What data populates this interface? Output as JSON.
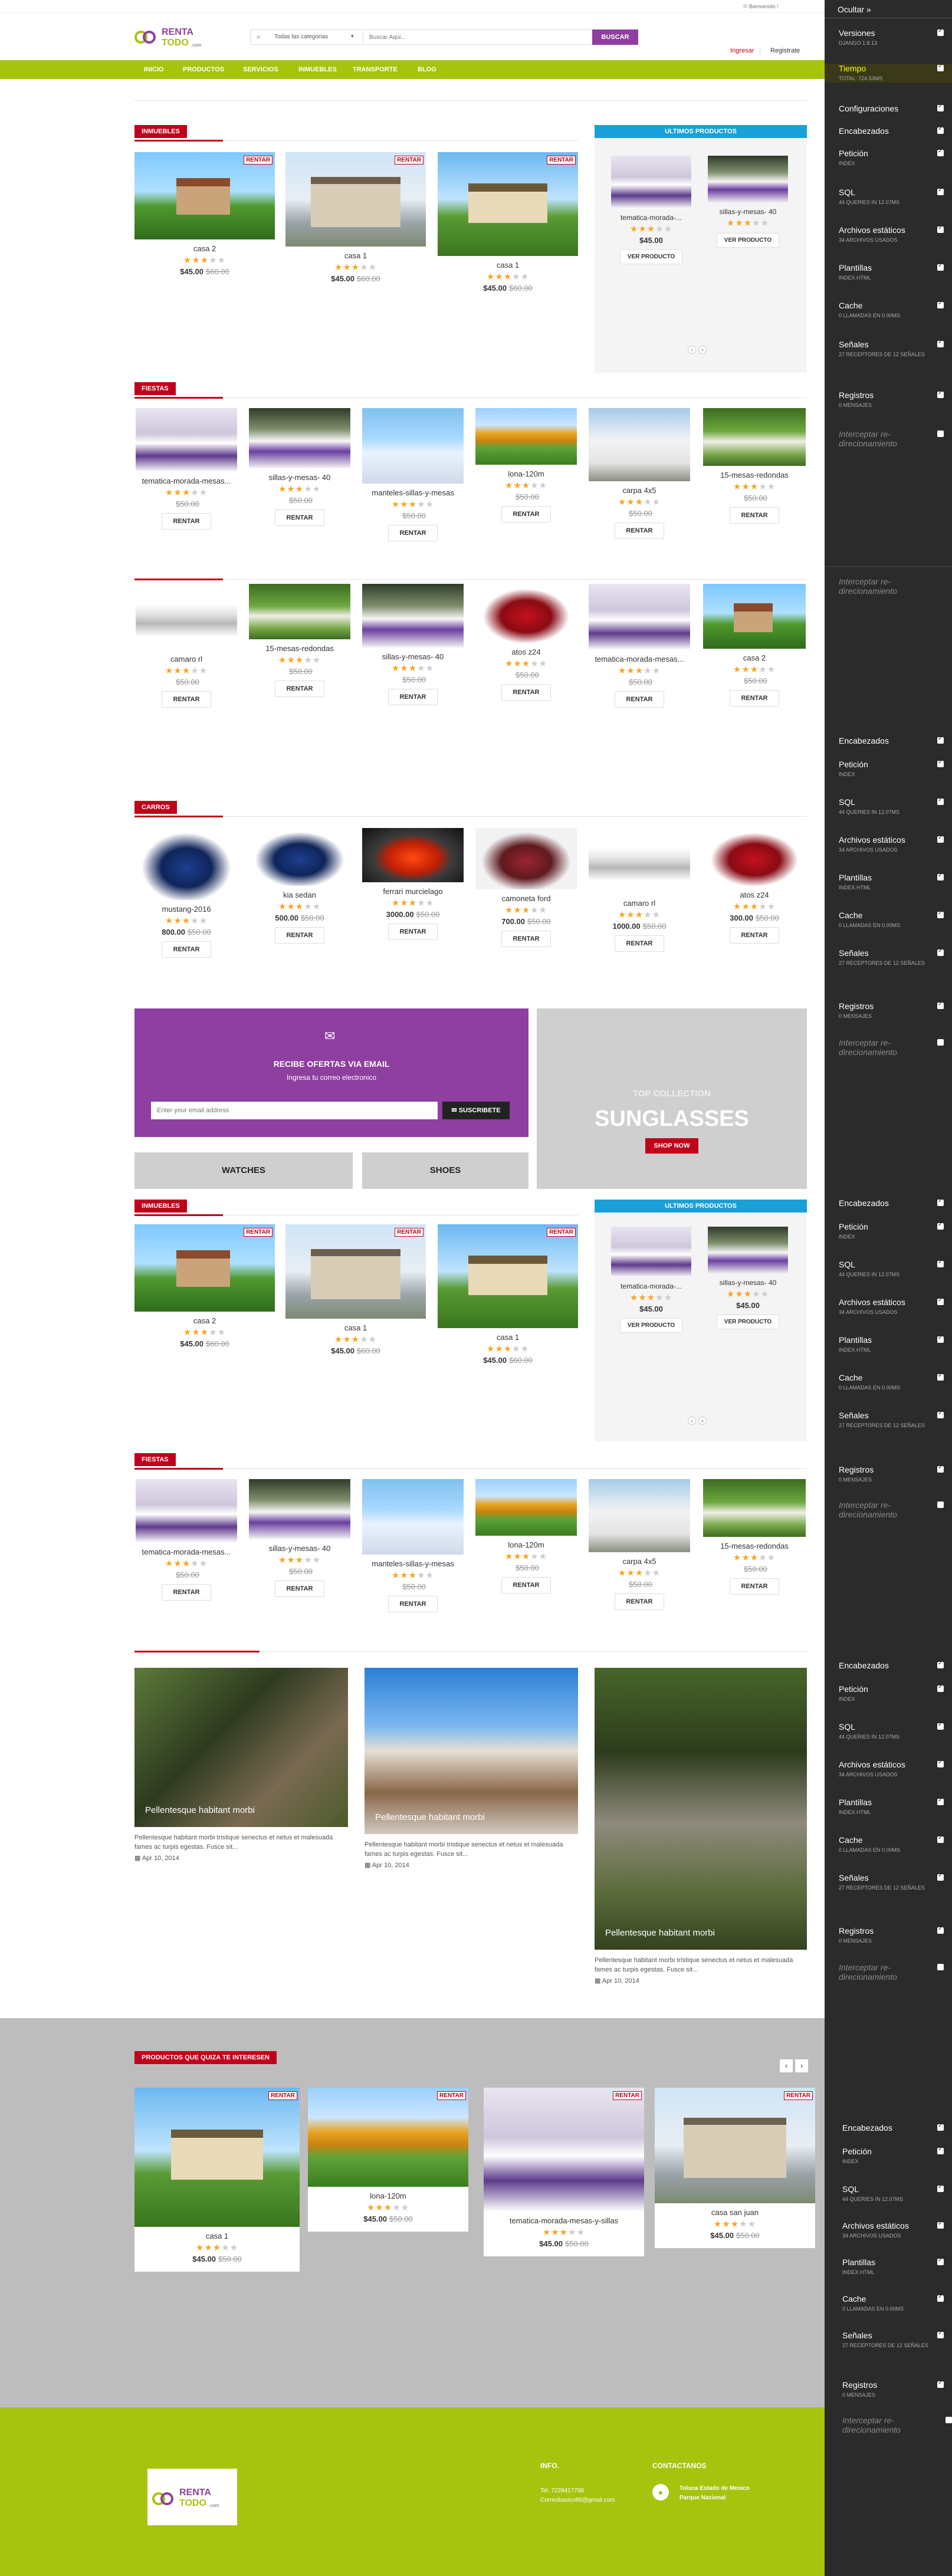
{
  "topbar": {
    "phone_icon": "phone-icon",
    "welcome": "Bienvenido !"
  },
  "logo": {
    "line1": "RENTA",
    "line2": "TODO",
    "suffix": ".com"
  },
  "search": {
    "category": "Todas las categorias",
    "placeholder": "Buscar Aqui...",
    "button": "BUSCAR"
  },
  "account": {
    "login": "Ingresar",
    "register": "Registrate"
  },
  "nav": [
    "INICIO",
    "PRODUCTOS",
    "SERVICIOS",
    "INMUEBLES",
    "TRANSPORTE",
    "BLOG"
  ],
  "colors": {
    "lime": "#a6c40e",
    "purple": "#8e3fa0",
    "red": "#c0001a",
    "cyan": "#1aa0d8"
  },
  "rent_tag": "RENTAR",
  "inmuebles": {
    "title": "INMUEBLES",
    "items": [
      {
        "name": "casa 2",
        "rating": 3,
        "price": "$45.00",
        "old": "$60.00"
      },
      {
        "name": "casa 1",
        "rating": 3,
        "price": "$45.00",
        "old": "$60.00"
      },
      {
        "name": "casa 1",
        "rating": 3,
        "price": "$45.00",
        "old": "$60.00"
      }
    ]
  },
  "ultimos": {
    "title": "ULTIMOS PRODUCTOS",
    "items": [
      {
        "name": "tematica-morada-...",
        "rating": 3,
        "price": "$45.00",
        "btn": "VER PRODUCTO"
      },
      {
        "name": "sillas-y-mesas- 40",
        "rating": 3,
        "price": "$45.00",
        "btn": "VER PRODUCTO"
      }
    ]
  },
  "fiestas": {
    "title": "FIESTAS",
    "row1": [
      {
        "name": "tematica-morada-mesas...",
        "rating": 3,
        "old": "$50.00"
      },
      {
        "name": "sillas-y-mesas- 40",
        "rating": 3,
        "old": "$50.00"
      },
      {
        "name": "manteles-sillas-y-mesas",
        "rating": 3,
        "old": "$50.00"
      },
      {
        "name": "lona-120m",
        "rating": 3,
        "old": "$50.00"
      },
      {
        "name": "carpa 4x5",
        "rating": 3,
        "old": "$50.00"
      },
      {
        "name": "15-mesas-redondas",
        "rating": 3,
        "old": "$50.00"
      }
    ],
    "row2": [
      {
        "name": "camaro rl",
        "rating": 3,
        "old": "$50.00"
      },
      {
        "name": "15-mesas-redondas",
        "rating": 3,
        "old": "$50.00"
      },
      {
        "name": "sillas-y-mesas- 40",
        "rating": 3,
        "old": "$50.00"
      },
      {
        "name": "atos z24",
        "rating": 3,
        "old": "$50.00"
      },
      {
        "name": "tematica-morada-mesas...",
        "rating": 3,
        "old": "$50.00"
      },
      {
        "name": "casa 2",
        "rating": 3,
        "old": "$50.00"
      }
    ],
    "btn": "RENTAR"
  },
  "carros": {
    "title": "CARROS",
    "items": [
      {
        "name": "mustang-2016",
        "rating": 3,
        "price": "800.00",
        "old": "$50.00"
      },
      {
        "name": "kia sedan",
        "rating": 3,
        "price": "500.00",
        "old": "$50.00"
      },
      {
        "name": "ferrari murcielago",
        "rating": 3,
        "price": "3000.00",
        "old": "$50.00"
      },
      {
        "name": "camoneta ford",
        "rating": 3,
        "price": "700.00",
        "old": "$50.00"
      },
      {
        "name": "camaro rl",
        "rating": 3,
        "price": "1000.00",
        "old": "$50.00"
      },
      {
        "name": "atos z24",
        "rating": 3,
        "price": "300.00",
        "old": "$50.00"
      }
    ]
  },
  "newsletter": {
    "title": "RECIBE OFERTAS VIA EMAIL",
    "subtitle": "Ingresa tu correo electronico",
    "placeholder": "Enter your email address",
    "button": "SUSCRIBETE"
  },
  "promo": {
    "kicker": "TOP COLLECTION",
    "title": "SUNGLASSES",
    "button": "SHOP NOW"
  },
  "watches": "WATCHES",
  "shoes": "SHOES",
  "blog": {
    "items": [
      {
        "title": "Pellentesque habitant morbi",
        "text": "Pellentesque habitant morbi tristique senectus et netus et malesuada fames ac turpis egestas. Fusce sit...",
        "date": "Apr 10, 2014"
      },
      {
        "title": "Pellentesque habitant morbi",
        "text": "Pellentesque habitant morbi tristique senectus et netus et malesuada fames ac turpis egestas. Fusce sit...",
        "date": "Apr 10, 2014"
      },
      {
        "title": "Pellentesque habitant morbi",
        "text": "Pellentesque habitant morbi tristique senectus et netus et malesuada fames ac turpis egestas. Fusce sit...",
        "date": "Apr 10, 2014"
      }
    ]
  },
  "interest": {
    "title": "PRODUCTOS QUE QUIZA TE INTERESEN",
    "items": [
      {
        "name": "casa 1",
        "rating": 3,
        "price": "$45.00",
        "old": "$50.00"
      },
      {
        "name": "lona-120m",
        "rating": 3,
        "price": "$45.00",
        "old": "$50.00"
      },
      {
        "name": "tematica-morada-mesas-y-sillas",
        "rating": 3,
        "price": "$45.00",
        "old": "$50.00"
      },
      {
        "name": "casa san juan",
        "rating": 3,
        "price": "$45.00",
        "old": "$50.00"
      }
    ]
  },
  "footer": {
    "info_title": "INFO.",
    "phone": "Tel. 7228417788",
    "email": "Correobasico88@gmail.com",
    "contact_title": "CONTACTANOS",
    "address1": "Toluca Estado de Mexico",
    "address2": "Parque Nacional"
  },
  "debug": {
    "hide": "Ocultar »",
    "versions": "Versiones",
    "versions_sub": "DJANGO 1.8.13",
    "time": "Tiempo",
    "time_sub": "TOTAL: 724.53ms",
    "config": "Configuraciones",
    "headers": "Encabezados",
    "request": "Petición",
    "request_sub": "INDEX",
    "sql": "SQL",
    "sql_sub": "44 QUERIES IN 12.07ms",
    "static": "Archivos estáticos",
    "static_sub": "34 ARCHIVOS USADOS",
    "templates": "Plantillas",
    "templates_sub": "INDEX.HTML",
    "cache": "Cache",
    "cache_sub": "0 LLAMADAS EN 0.00ms",
    "signals": "Señales",
    "signals_sub": "27 RECEPTORES DE 12 SEÑALES",
    "logging": "Registros",
    "logging_sub": "0 MENSAJES",
    "intercept": "Interceptar re-direcionamiento"
  }
}
